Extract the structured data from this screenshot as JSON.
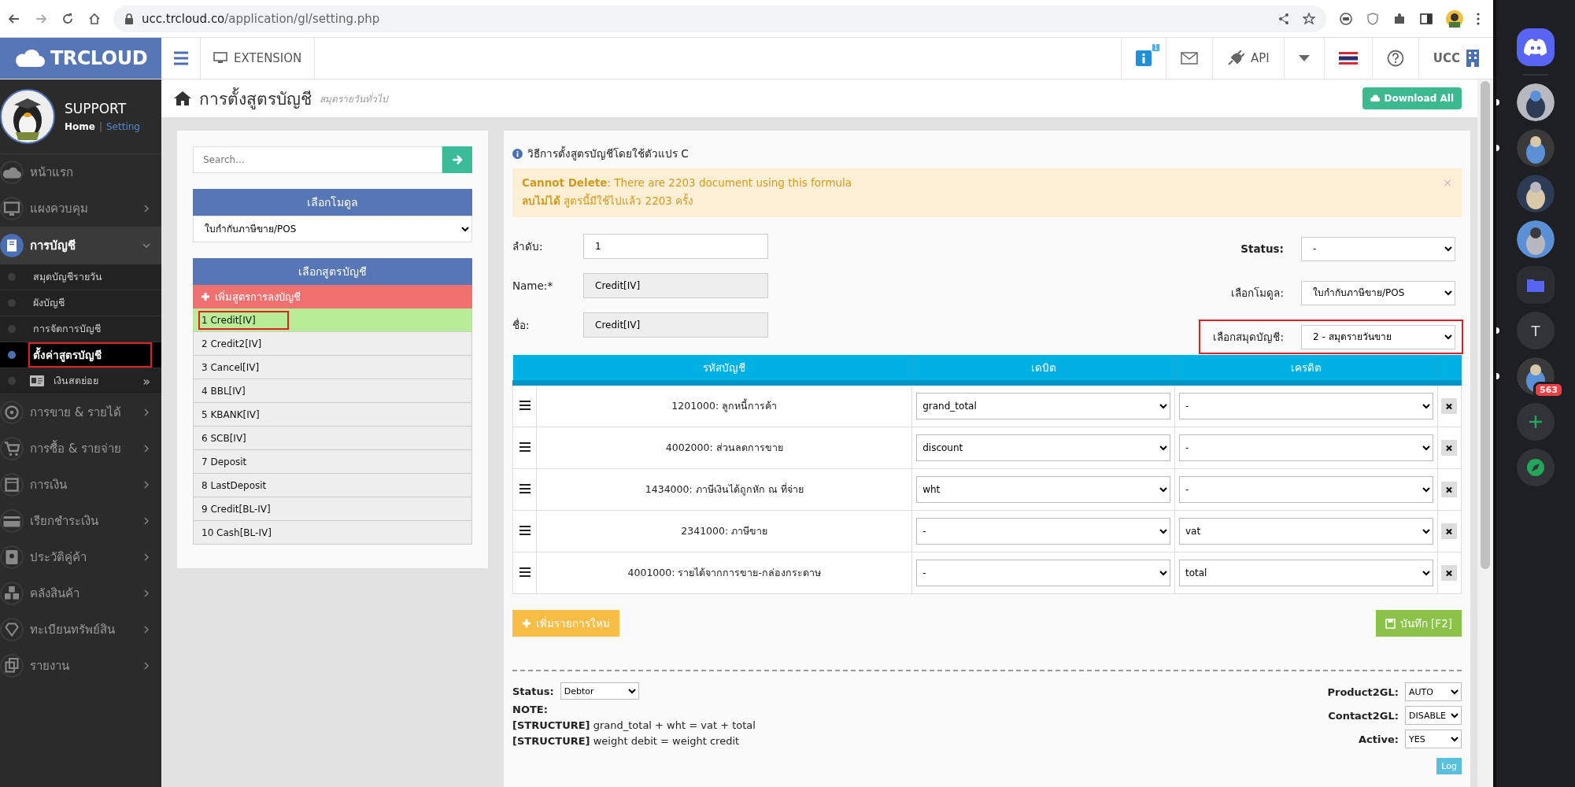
{
  "browser": {
    "host": "ucc.trcloud.co",
    "path": "/application/gl/setting.php"
  },
  "header": {
    "logo": "TRCLOUD",
    "extension": "EXTENSION",
    "info_badge": "1",
    "api": "API",
    "user": "UCC"
  },
  "profile": {
    "name": "SUPPORT",
    "home": "Home",
    "separator": "|",
    "setting": "Setting"
  },
  "sidebar": {
    "items": [
      {
        "label": "หน้าแรก",
        "arrow": false,
        "expanded": false
      },
      {
        "label": "แผงควบคุม",
        "arrow": true,
        "expanded": false
      },
      {
        "label": "การบัญชี",
        "arrow": true,
        "expanded": true,
        "children": [
          {
            "label": "สมุดบัญชีรายวัน",
            "selected": false,
            "annotated": false
          },
          {
            "label": "ผังบัญชี",
            "selected": false,
            "annotated": false
          },
          {
            "label": "การจัดการบัญชี",
            "selected": false,
            "annotated": false
          },
          {
            "label": "ตั้งค่าสูตรบัญชี",
            "selected": true,
            "annotated": true
          },
          {
            "label": "เงินสดย่อย",
            "selected": false,
            "annotated": false,
            "kind": "submenu",
            "more": "»"
          }
        ]
      },
      {
        "label": "การขาย & รายได้",
        "arrow": true,
        "expanded": false
      },
      {
        "label": "การซื้อ & รายจ่าย",
        "arrow": true,
        "expanded": false
      },
      {
        "label": "การเงิน",
        "arrow": true,
        "expanded": false
      },
      {
        "label": "เรียกชำระเงิน",
        "arrow": true,
        "expanded": false
      },
      {
        "label": "ประวัติคู่ค้า",
        "arrow": true,
        "expanded": false
      },
      {
        "label": "คลังสินค้า",
        "arrow": true,
        "expanded": false
      },
      {
        "label": "ทะเบียนทรัพย์สิน",
        "arrow": true,
        "expanded": false
      },
      {
        "label": "รายงาน",
        "arrow": true,
        "expanded": false
      }
    ]
  },
  "page": {
    "title": "การตั้งสูตรบัญชี",
    "subtitle": "สมุดรายวันทั่วไป",
    "download": "Download All"
  },
  "left_panel": {
    "search": {
      "placeholder": "Search..."
    },
    "module_header": "เลือกโมดูล",
    "module_value": "ใบกำกับภาษีขาย/POS",
    "formula_header": "เลือกสูตรบัญชี",
    "add_formula": "เพิ่มสูตรการลงบัญชี",
    "formulas": [
      {
        "label": "1 Credit[IV]",
        "selected": true,
        "annotated": true
      },
      {
        "label": "2 Credit2[IV]",
        "selected": false,
        "annotated": false
      },
      {
        "label": "3 Cancel[IV]",
        "selected": false,
        "annotated": false
      },
      {
        "label": "4 BBL[IV]",
        "selected": false,
        "annotated": false
      },
      {
        "label": "5 KBANK[IV]",
        "selected": false,
        "annotated": false
      },
      {
        "label": "6 SCB[IV]",
        "selected": false,
        "annotated": false
      },
      {
        "label": "7 Deposit",
        "selected": false,
        "annotated": false
      },
      {
        "label": "8 LastDeposit",
        "selected": false,
        "annotated": false
      },
      {
        "label": "9 Credit[BL-IV]",
        "selected": false,
        "annotated": false
      },
      {
        "label": "10 Cash[BL-IV]",
        "selected": false,
        "annotated": false
      }
    ]
  },
  "main": {
    "info": "วิธีการตั้งสูตรบัญชีโดยใช้ตัวแปร C",
    "alert": [
      "**Cannot Delete**: There are 2203 document using this formula",
      "**ลบไม่ได้** สูตรนี้มีใช้ไปแล้ว 2203 ครั้ง"
    ],
    "alert_close": "×",
    "left_fields": [
      {
        "label": "ลำดับ:",
        "value": "1",
        "disabled": false
      },
      {
        "label": "Name:*",
        "value": "Credit[IV]",
        "disabled": true
      },
      {
        "label": "ชื่อ:",
        "value": "Credit[IV]",
        "disabled": true
      }
    ],
    "right_fields": [
      {
        "label": "Status:",
        "value": "-",
        "bold": true,
        "annotated": false
      },
      {
        "label": "เลือกโมดูล:",
        "value": "ใบกำกับภาษีขาย/POS",
        "bold": false,
        "annotated": false
      },
      {
        "label": "เลือกสมุดบัญชี:",
        "value": "2 - สมุดรายวันขาย",
        "bold": false,
        "annotated": true
      }
    ],
    "table": {
      "columns": [
        "รหัสบัญชี",
        "เดบิต",
        "เครดิต"
      ],
      "rows": [
        {
          "account": "1201000: ลูกหนี้การค้า",
          "debit": "grand_total",
          "credit": "-"
        },
        {
          "account": "4002000: ส่วนลดการขาย",
          "debit": "discount",
          "credit": "-"
        },
        {
          "account": "1434000: ภาษีเงินได้ถูกหัก ณ ที่จ่าย",
          "debit": "wht",
          "credit": "-"
        },
        {
          "account": "2341000: ภาษีขาย",
          "debit": "-",
          "credit": "vat"
        },
        {
          "account": "4001000: รายได้จากการขาย-กล่องกระดาษ",
          "debit": "-",
          "credit": "total"
        }
      ]
    },
    "add_row": "เพิ่มรายการใหม่",
    "save": "บันทึก [F2]",
    "status": {
      "label": "Status:",
      "value": "Debtor"
    },
    "note": "NOTE:",
    "structure": [
      "**[STRUCTURE]** grand_total + wht = vat + total",
      "**[STRUCTURE]** weight debit = weight credit"
    ],
    "options": [
      {
        "label": "Product2GL:",
        "value": "AUTO"
      },
      {
        "label": "Contact2GL:",
        "value": "DISABLE"
      },
      {
        "label": "Active:",
        "value": "YES"
      }
    ],
    "log": "Log"
  },
  "discord": {
    "servers": [
      {
        "kind": "logo",
        "unread": false
      },
      {
        "kind": "picture",
        "unread": true
      },
      {
        "kind": "picture",
        "unread": true
      },
      {
        "kind": "picture",
        "unread": false
      },
      {
        "kind": "picture",
        "unread": false
      },
      {
        "kind": "folder",
        "unread": false
      },
      {
        "kind": "letter",
        "text": "T",
        "unread": true
      },
      {
        "kind": "picture",
        "unread": true,
        "badge": "563"
      },
      {
        "kind": "add",
        "unread": false
      },
      {
        "kind": "explore",
        "unread": false
      }
    ]
  }
}
